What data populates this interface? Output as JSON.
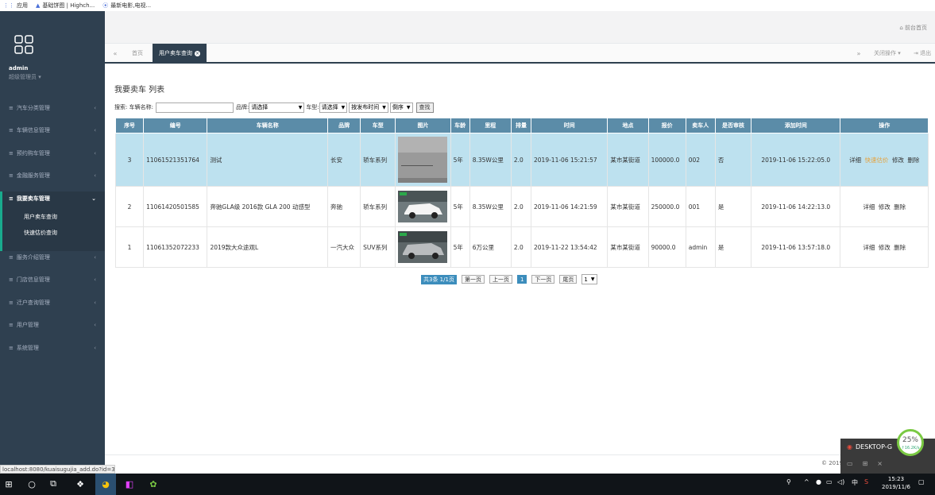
{
  "bookmarks": [
    {
      "icon": "apps-grid-icon",
      "label": "应用"
    },
    {
      "icon": "highcharts-icon",
      "label": "基础饼图 | Highch..."
    },
    {
      "icon": "play-icon",
      "label": "最新电影,电视..."
    }
  ],
  "sidebar": {
    "user_name": "admin",
    "user_role": "超级管理员 ▾",
    "menu": [
      {
        "label": "汽车分类管理"
      },
      {
        "label": "车辆信息管理"
      },
      {
        "label": "预约购车管理"
      },
      {
        "label": "金融服务管理"
      },
      {
        "label": "我要卖车管理"
      },
      {
        "label": "服务介绍管理"
      },
      {
        "label": "门店信息管理"
      },
      {
        "label": "迁户查询管理"
      },
      {
        "label": "用户管理"
      },
      {
        "label": "系统管理"
      }
    ],
    "submenu": [
      "用户卖车查询",
      "快速估价查询"
    ]
  },
  "header": {
    "home_link": "前台首页"
  },
  "tabs": {
    "home": "首页",
    "active": "用户卖车查询",
    "close_ops": "关闭操作 ▾",
    "logout": "退出"
  },
  "page": {
    "heading": "我要卖车 列表",
    "search": {
      "label_name": "搜索: 车辆名称:",
      "name_value": "",
      "label_brand": "品牌:",
      "brand_value": "请选择",
      "label_type": "车型:",
      "type_value": "请选择",
      "sort_value": "按发布时间",
      "order_value": "倒序",
      "search_button": "查找"
    }
  },
  "table": {
    "columns": [
      "序号",
      "编号",
      "车辆名称",
      "品牌",
      "车型",
      "图片",
      "车龄",
      "里程",
      "排量",
      "时间",
      "地点",
      "报价",
      "卖车人",
      "是否审核",
      "添加时间",
      "操作"
    ],
    "rows": [
      {
        "seq": "3",
        "code": "11061521351764",
        "name": "测试",
        "brand": "长安",
        "type": "轿车系列",
        "age": "5年",
        "mileage": "8.35W公里",
        "displacement": "2.0",
        "time": "2019-11-06 15:21:57",
        "location": "某市某街道",
        "price": "100000.0",
        "seller": "002",
        "audited": "否",
        "added": "2019-11-06 15:22:05.0",
        "ops": [
          "详细",
          "快速估价",
          "修改",
          "删除"
        ]
      },
      {
        "seq": "2",
        "code": "11061420501585",
        "name": "奔驰GLA级 2016款 GLA 200 动感型",
        "brand": "奔驰",
        "type": "轿车系列",
        "age": "5年",
        "mileage": "8.35W公里",
        "displacement": "2.0",
        "time": "2019-11-06 14:21:59",
        "location": "某市某街道",
        "price": "250000.0",
        "seller": "001",
        "audited": "是",
        "added": "2019-11-06 14:22:13.0",
        "ops": [
          "详细",
          "修改",
          "删除"
        ]
      },
      {
        "seq": "1",
        "code": "11061352072233",
        "name": "2019款大众途观L",
        "brand": "一汽大众",
        "type": "SUV系列",
        "age": "5年",
        "mileage": "6万公里",
        "displacement": "2.0",
        "time": "2019-11-22 13:54:42",
        "location": "某市某街道",
        "price": "90000.0",
        "seller": "admin",
        "audited": "是",
        "added": "2019-11-06 13:57:18.0",
        "ops": [
          "详细",
          "修改",
          "删除"
        ]
      }
    ]
  },
  "pager": {
    "info": "共3条  1/1页",
    "first": "第一页",
    "prev": "上一页",
    "current": "1",
    "next": "下一页",
    "last": "尾页",
    "jump": "1"
  },
  "footer": {
    "copyright": "© 2019"
  },
  "status_url": "localhost:8080/kuaisugujia_add.do?id=3",
  "desktop_popup": {
    "title": "DESKTOP-G"
  },
  "gauge": {
    "percent": "25%",
    "rate": "↑16.2K/s"
  },
  "taskbar": {
    "time": "15:23",
    "date": "2019/11/6",
    "ime": "中"
  },
  "colors": {
    "sidebar": "#2f4050",
    "header": "#5b8ca8",
    "highlight_row": "#bde1ef",
    "accent": "#3c8dbc"
  }
}
